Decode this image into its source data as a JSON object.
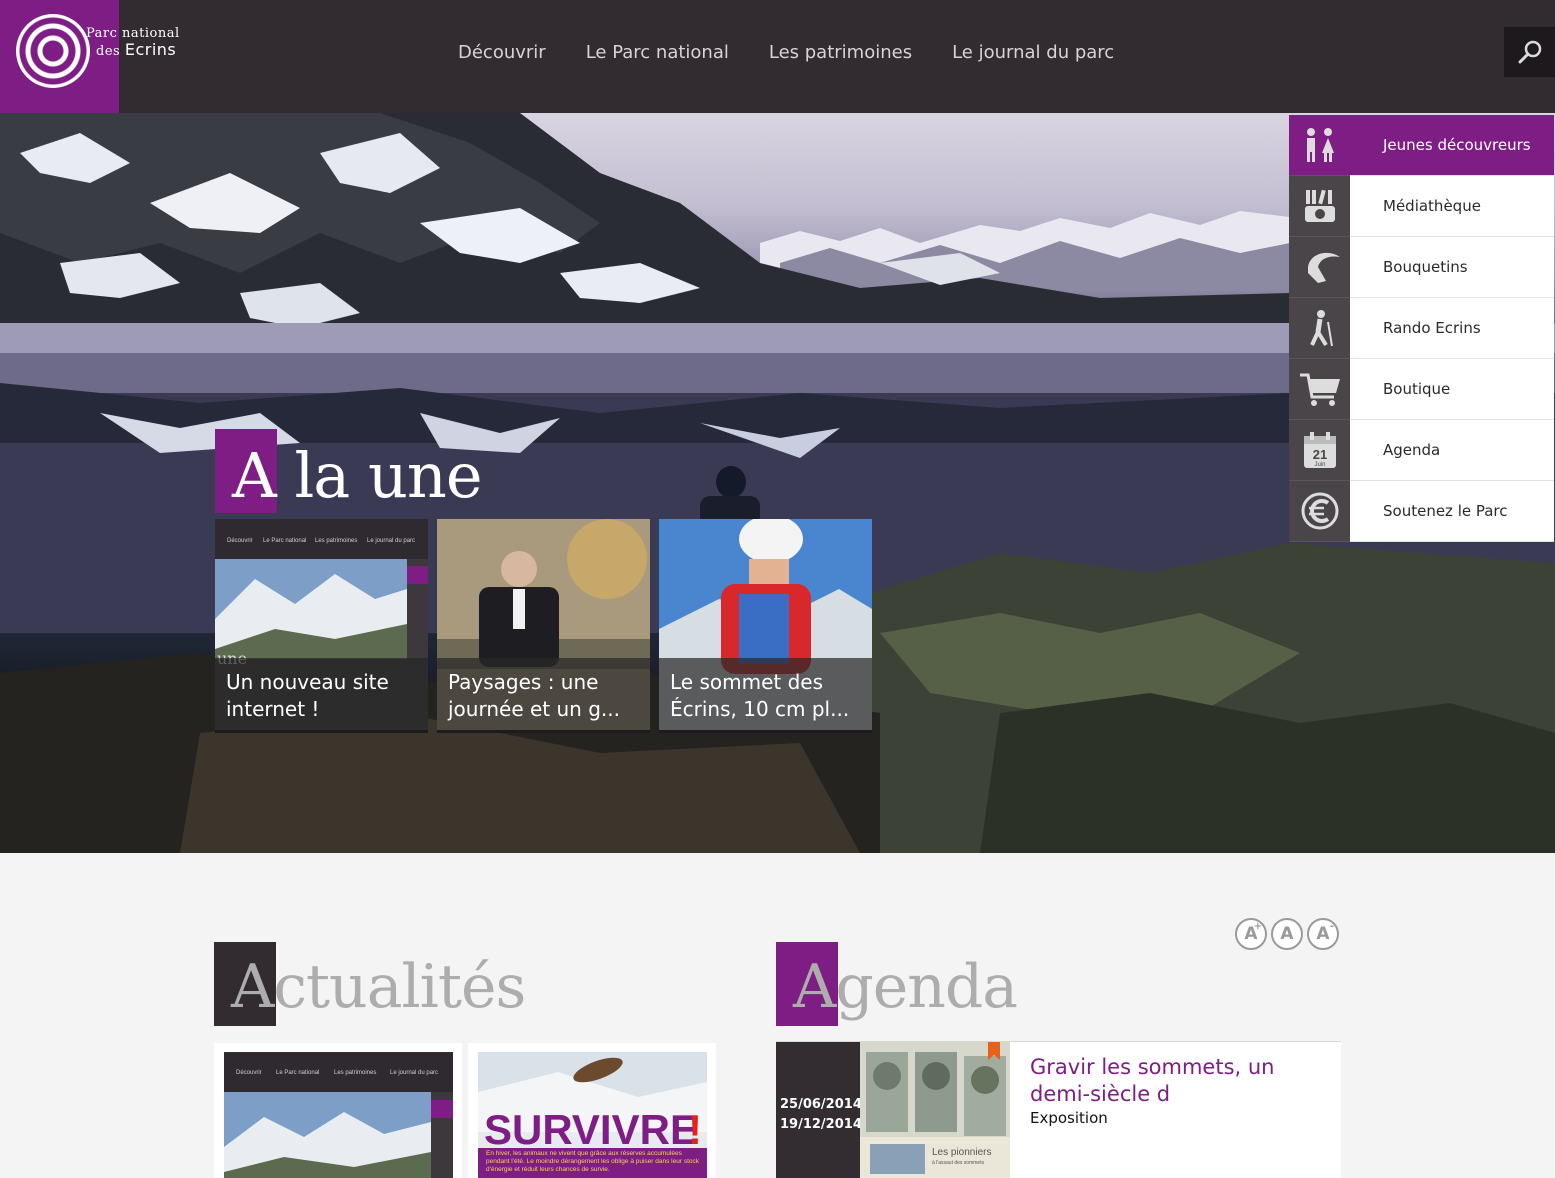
{
  "header": {
    "logo_line1": "Parc national",
    "logo_line2_prefix": "des",
    "logo_line2_name": "Ecrins",
    "nav": [
      "Découvrir",
      "Le Parc national",
      "Les patrimoines",
      "Le journal du parc"
    ]
  },
  "hero": {
    "section_title": "A la une",
    "cards": [
      {
        "caption": "Un nouveau site internet !"
      },
      {
        "caption": "Paysages : une journée et un g..."
      },
      {
        "caption": "Le sommet des Écrins, 10 cm pl..."
      }
    ],
    "thumb_nav": [
      "Découvrir",
      "Le Parc national",
      "Les patrimoines",
      "Le journal du parc"
    ],
    "thumb_une_fragment": "une"
  },
  "quick_menu": [
    {
      "label": "Jeunes découvreurs",
      "icon": "kids-icon",
      "active": true
    },
    {
      "label": "Médiathèque",
      "icon": "media-icon",
      "active": false
    },
    {
      "label": "Bouquetins",
      "icon": "ibex-icon",
      "active": false
    },
    {
      "label": "Rando Ecrins",
      "icon": "hiker-icon",
      "active": false
    },
    {
      "label": "Boutique",
      "icon": "cart-icon",
      "active": false
    },
    {
      "label": "Agenda",
      "icon": "calendar-icon",
      "active": false,
      "icon_day": "21",
      "icon_month": "Juin"
    },
    {
      "label": "Soutenez le Parc",
      "icon": "euro-icon",
      "active": false
    }
  ],
  "font_controls": [
    "A",
    "A",
    "A"
  ],
  "font_controls_sup": [
    "+",
    "",
    "-"
  ],
  "actualites": {
    "title": "Actualités",
    "survivre_title": "SURVIVRE",
    "survivre_mark": "!",
    "survivre_text": "En hiver, les animaux ne vivent que grâce aux réserves accumulées pendant l'été. Le moindre dérangement les oblige à puiser dans leur stock d'énergie et réduit leurs chances de survie."
  },
  "agenda": {
    "title": "Agenda",
    "event": {
      "date_start": "25/06/2014",
      "date_end": "19/12/2014",
      "title": "Gravir les sommets, un demi-siècle d",
      "type": "Exposition",
      "poster_text_1": "Les pionniers",
      "poster_text_2": "à l'assaut des sommets"
    }
  },
  "colors": {
    "accent": "#7e1d84",
    "dark": "#322c31",
    "icon_bg": "#4a4549"
  }
}
